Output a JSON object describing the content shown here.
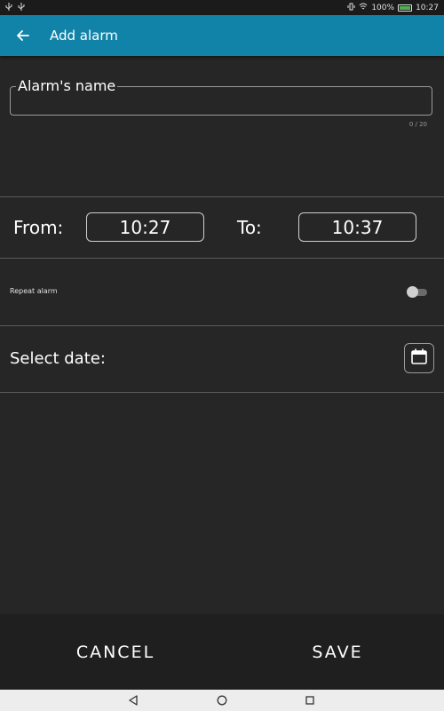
{
  "status_bar": {
    "left_icons": [
      "usb-icon",
      "usb-icon"
    ],
    "battery_percent": "100%",
    "time": "10:27"
  },
  "app_bar": {
    "title": "Add alarm",
    "color": "#1283a8"
  },
  "name_field": {
    "label": "Alarm's name",
    "value": "",
    "counter": "0 / 20"
  },
  "time_range": {
    "from_label": "From:",
    "from_value": "10:27",
    "to_label": "To:",
    "to_value": "10:37"
  },
  "repeat": {
    "label": "Repeat alarm",
    "enabled": false
  },
  "date": {
    "label": "Select date:",
    "icon": "calendar-icon"
  },
  "actions": {
    "cancel_label": "CANCEL",
    "save_label": "SAVE"
  },
  "nav_bar": {
    "icons": [
      "back-icon",
      "home-icon",
      "recents-icon"
    ]
  }
}
